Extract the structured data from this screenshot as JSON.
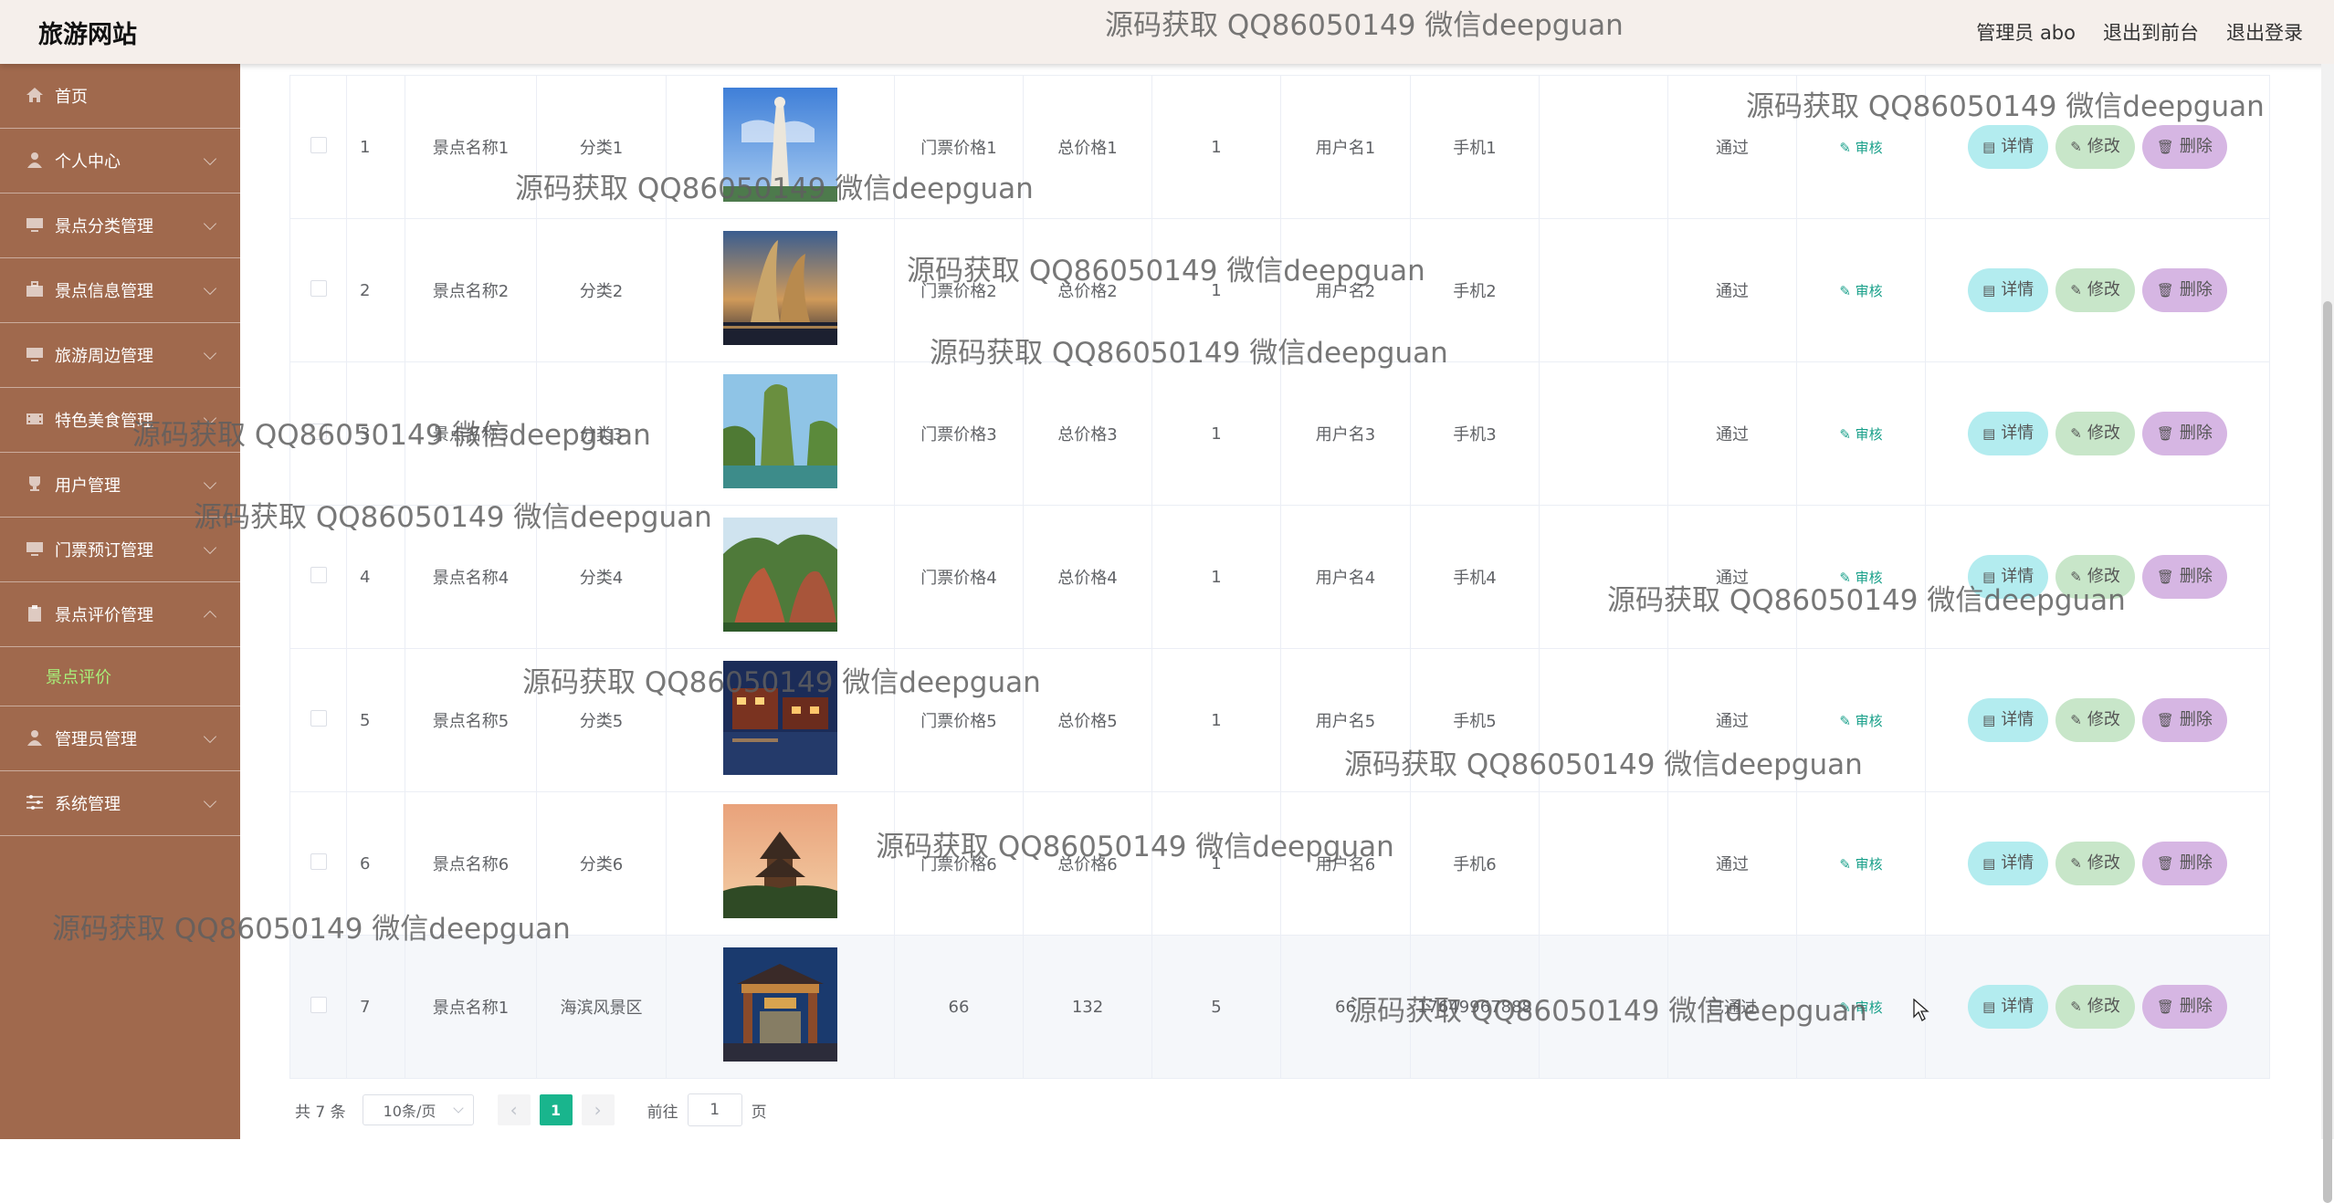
{
  "header": {
    "site_title": "旅游网站",
    "admin_label": "管理员 abo",
    "to_front": "退出到前台",
    "logout": "退出登录"
  },
  "sidebar": {
    "items": [
      {
        "label": "首页",
        "icon": "home-icon"
      },
      {
        "label": "个人中心",
        "icon": "user-icon"
      },
      {
        "label": "景点分类管理",
        "icon": "monitor-icon"
      },
      {
        "label": "景点信息管理",
        "icon": "briefcase-icon"
      },
      {
        "label": "旅游周边管理",
        "icon": "monitor-icon"
      },
      {
        "label": "特色美食管理",
        "icon": "film-icon"
      },
      {
        "label": "用户管理",
        "icon": "trophy-icon"
      },
      {
        "label": "门票预订管理",
        "icon": "monitor-icon"
      },
      {
        "label": "景点评价管理",
        "icon": "clipboard-icon"
      },
      {
        "label": "管理员管理",
        "icon": "user-icon"
      },
      {
        "label": "系统管理",
        "icon": "settings-icon"
      }
    ],
    "submenu_active": "景点评价"
  },
  "table": {
    "rows": [
      {
        "no": "1",
        "name": "景点名称1",
        "category": "分类1",
        "ticket_price": "门票价格1",
        "total_price": "总价格1",
        "qty": "1",
        "username": "用户名1",
        "phone": "手机1",
        "reply": "",
        "status": "通过",
        "image_theme": "statue"
      },
      {
        "no": "2",
        "name": "景点名称2",
        "category": "分类2",
        "ticket_price": "门票价格2",
        "total_price": "总价格2",
        "qty": "1",
        "username": "用户名2",
        "phone": "手机2",
        "reply": "",
        "status": "通过",
        "image_theme": "night-sails"
      },
      {
        "no": "3",
        "name": "景点名称3",
        "category": "分类3",
        "ticket_price": "门票价格3",
        "total_price": "总价格3",
        "qty": "1",
        "username": "用户名3",
        "phone": "手机3",
        "reply": "",
        "status": "通过",
        "image_theme": "karst-river"
      },
      {
        "no": "4",
        "name": "景点名称4",
        "category": "分类4",
        "ticket_price": "门票价格4",
        "total_price": "总价格4",
        "qty": "1",
        "username": "用户名4",
        "phone": "手机4",
        "reply": "",
        "status": "通过",
        "image_theme": "red-cliffs"
      },
      {
        "no": "5",
        "name": "景点名称5",
        "category": "分类5",
        "ticket_price": "门票价格5",
        "total_price": "总价格5",
        "qty": "1",
        "username": "用户名5",
        "phone": "手机5",
        "reply": "",
        "status": "通过",
        "image_theme": "water-town-night"
      },
      {
        "no": "6",
        "name": "景点名称6",
        "category": "分类6",
        "ticket_price": "门票价格6",
        "total_price": "总价格6",
        "qty": "1",
        "username": "用户名6",
        "phone": "手机6",
        "reply": "",
        "status": "通过",
        "image_theme": "pagoda-sunset"
      },
      {
        "no": "7",
        "name": "景点名称1",
        "category": "海滨风景区",
        "ticket_price": "66",
        "total_price": "132",
        "qty": "5",
        "username": "66",
        "phone": "17649967888",
        "reply": "",
        "status": "已通过",
        "image_theme": "gate-night"
      }
    ],
    "audit_label": "审核",
    "detail_label": "详情",
    "edit_label": "修改",
    "delete_label": "删除"
  },
  "pagination": {
    "total": "共 7 条",
    "page_size": "10条/页",
    "current_page": "1",
    "goto_prefix": "前往",
    "goto_value": "1",
    "goto_suffix": "页"
  },
  "watermark": "源码获取 QQ86050149 微信deepguan",
  "colors": {
    "sidebar": "#a0694d",
    "header": "#f5efeb",
    "active_submenu": "#a8f07a",
    "page_active": "#19b58d",
    "detail_btn": "#b3ecef",
    "edit_btn": "#c8e6c9",
    "delete_btn": "#d6b6e3"
  }
}
